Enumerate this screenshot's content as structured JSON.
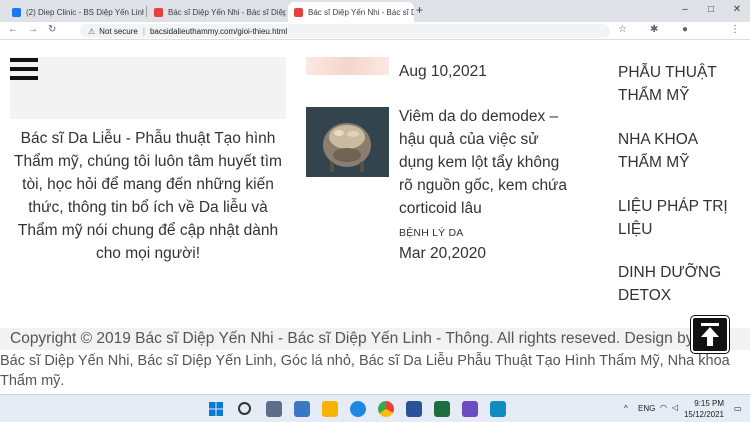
{
  "browser": {
    "tabs": [
      {
        "title": "(2) Diep Clinic - BS Diệp Yến Linh",
        "active": false,
        "favicon_color": "#1877f2"
      },
      {
        "title": "Bác sĩ Diệp Yến Nhi - Bác sĩ Diệp",
        "active": false,
        "favicon_color": "#e8403d"
      },
      {
        "title": "Bác sĩ Diệp Yến Nhi - Bác sĩ Diệp",
        "active": true,
        "favicon_color": "#e8403d"
      }
    ],
    "new_tab": "+",
    "window_controls": {
      "minimize": "–",
      "maximize": "□",
      "close": "✕"
    },
    "security_label": "Not secure",
    "url": "bacsidalieuthammy.com/gioi-thieu.html"
  },
  "page": {
    "about_text": "Bác sĩ Da Liễu - Phẫu thuật Tạo hình Thẩm mỹ, chúng tôi luôn tâm huyết tìm tòi, học hỏi để mang đến những kiến thức, thông tin bổ ích về Da liễu và Thẩm mỹ nói chung để cập nhật dành cho mọi người!",
    "posts": [
      {
        "date": "Aug 10,2021"
      },
      {
        "title": "Viêm da do demodex – hậu quả của việc sử dụng kem lột tẩy không rõ nguồn gốc, kem chứa corticoid lâu",
        "category": "BỆNH LÝ DA",
        "date": "Mar 20,2020"
      }
    ],
    "sidebar_links": [
      "PHẪU THUẬT THẨM MỸ",
      "NHA KHOA THẨM MỸ",
      "LIỆU PHÁP TRỊ LIỆU",
      "DINH DƯỠNG DETOX"
    ],
    "copyright": "Copyright © 2019 Bác sĩ Diệp Yến Nhi - Bác sĩ Diệp Yến Linh - Thông. All rights reseved. Design by Gi",
    "tags": "Bác sĩ Diệp Yến Nhi, Bác sĩ Diệp Yến Linh, Góc lá nhỏ, Bác sĩ Da Liễu Phẫu Thuật Tạo Hình Thẩm Mỹ, Nha khoa Thẩm mỹ."
  },
  "taskbar": {
    "language": "ENG",
    "time": "9:15 PM",
    "date": "15/12/2021"
  }
}
